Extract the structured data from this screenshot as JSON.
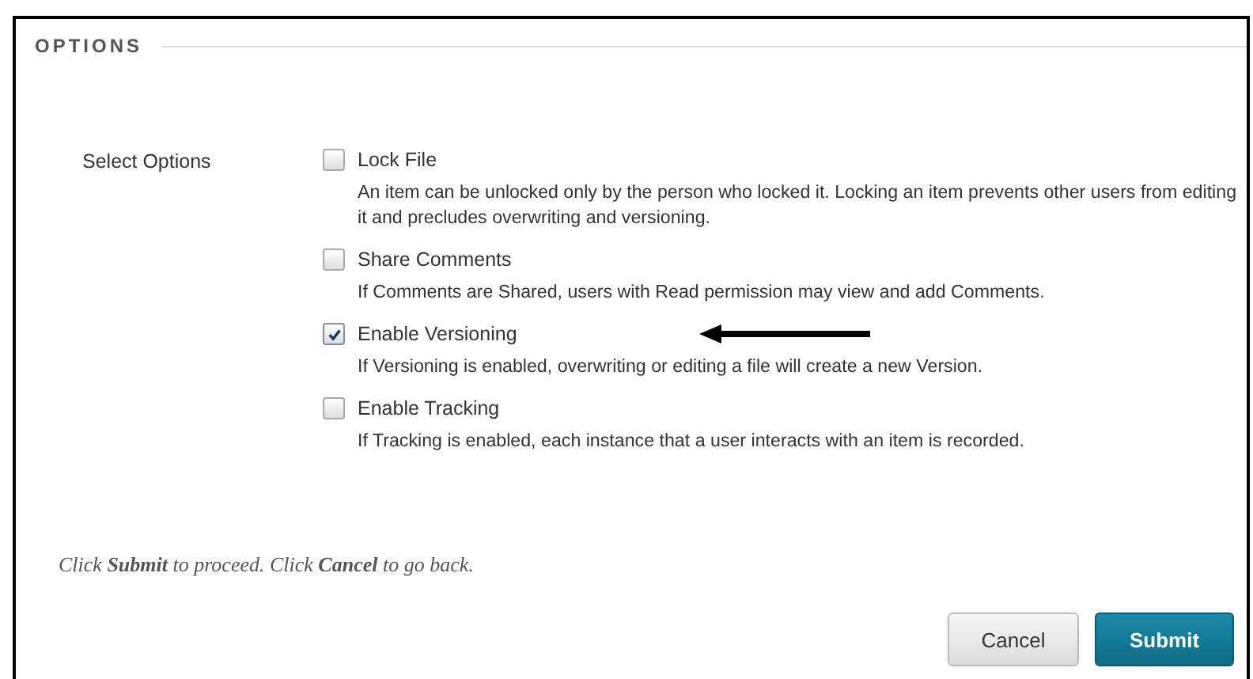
{
  "section": {
    "title": "OPTIONS"
  },
  "field_label": "Select Options",
  "options": [
    {
      "label": "Lock File",
      "checked": false,
      "description": "An item can be unlocked only by the person who locked it. Locking an item prevents other users from editing it and precludes overwriting and versioning."
    },
    {
      "label": "Share Comments",
      "checked": false,
      "description": "If Comments are Shared, users with Read permission may view and add Comments."
    },
    {
      "label": "Enable Versioning",
      "checked": true,
      "description": "If Versioning is enabled, overwriting or editing a file will create a new Version."
    },
    {
      "label": "Enable Tracking",
      "checked": false,
      "description": "If Tracking is enabled, each instance that a user interacts with an item is recorded."
    }
  ],
  "footer_note": "Click **Submit** to proceed. Click **Cancel** to go back.",
  "buttons": [
    {
      "label": "Cancel",
      "kind": "secondary"
    },
    {
      "label": "Submit",
      "kind": "primary"
    }
  ]
}
